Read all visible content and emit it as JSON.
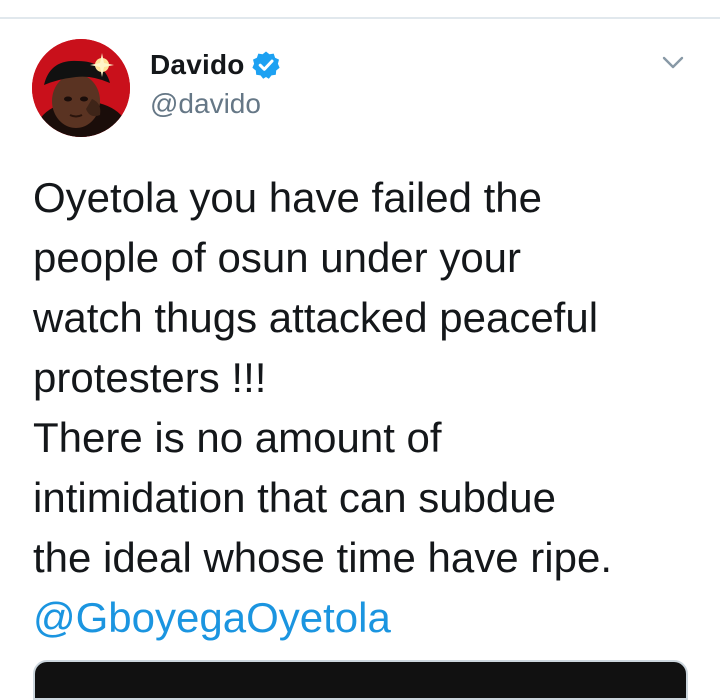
{
  "user": {
    "display_name": "Davido",
    "handle": "@davido",
    "verified": true
  },
  "icons": {
    "verified": "verified-badge-icon",
    "menu": "chevron-down-icon",
    "avatar": "profile-photo"
  },
  "tweet": {
    "lines": [
      "Oyetola you have failed the",
      "people of osun under your",
      "watch thugs attacked peaceful",
      "protesters !!!",
      "There is no amount of",
      "intimidation that can subdue",
      "the ideal whose time have ripe."
    ],
    "mention": "@GboyegaOyetola"
  },
  "colors": {
    "text": "#14171a",
    "secondary": "#657786",
    "link": "#1b95e0",
    "verified": "#1da1f2",
    "divider": "#e1e8ed"
  }
}
